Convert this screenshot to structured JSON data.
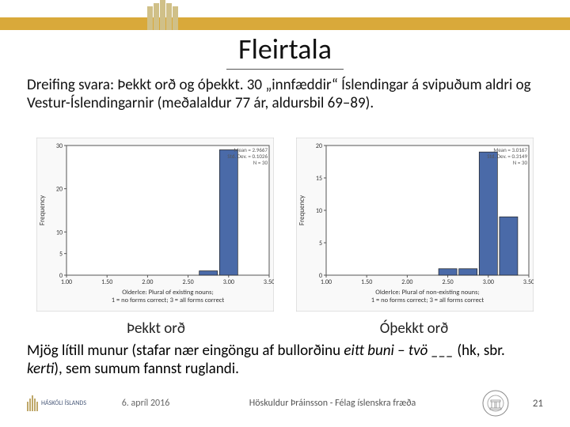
{
  "title": "Fleirtala",
  "body_text": "Dreifing svara: Þekkt orð og óþekkt. 30 „innfæddir“ Íslendingar á svipuðum aldri og Vestur-Íslendingarnir (meðalaldur 77 ár, aldursbil 69–89).",
  "chart_data": [
    {
      "type": "bar",
      "title": "",
      "ylabel": "Frequency",
      "xlabel": "OlderIce: Plural of existing nouns;\n1 = no forms correct; 3 = all forms correct",
      "xlim": [
        1.0,
        3.5
      ],
      "ylim": [
        0,
        30
      ],
      "yticks": [
        0,
        5,
        10,
        20,
        30
      ],
      "bars": [
        {
          "x": 2.75,
          "value": 1,
          "fill": "#4a6aa8"
        },
        {
          "x": 3.0,
          "value": 29,
          "fill": "#4a6aa8"
        }
      ],
      "stats": {
        "mean": "2.9667",
        "stddev": "0.1026",
        "n": "30"
      },
      "caption": "Þekkt orð"
    },
    {
      "type": "bar",
      "title": "",
      "ylabel": "Frequency",
      "xlabel": "OlderIce: Plural of non-existing nouns;\n1 = no forms correct; 3 = all forms correct",
      "xlim": [
        1.0,
        3.5
      ],
      "ylim": [
        0,
        20
      ],
      "yticks": [
        0,
        5,
        10,
        15,
        20
      ],
      "bars": [
        {
          "x": 2.5,
          "value": 1,
          "fill": "#4a6aa8"
        },
        {
          "x": 2.75,
          "value": 1,
          "fill": "#4a6aa8"
        },
        {
          "x": 3.0,
          "value": 19,
          "fill": "#4a6aa8"
        },
        {
          "x": 3.25,
          "value": 9,
          "fill": "#4a6aa8"
        }
      ],
      "stats": {
        "mean": "3.0167",
        "stddev": "0.3149",
        "n": "30"
      },
      "caption": "Óþekkt orð"
    }
  ],
  "lower_text": {
    "pre": "Mjög lítill munur (stafar nær eingöngu af bullorðinu ",
    "it1": "eitt buni",
    "mid": " – ",
    "it2": "tvö ___",
    "paren": " (hk, sbr. ",
    "it3": "kerti",
    "post": "), sem sumum fannst ruglandi."
  },
  "footer": {
    "uni_label": "HÁSKÓLI ÍSLANDS",
    "date": "6. apríl 2016",
    "center": "Höskuldur Þráinsson - Félag íslenskra fræða",
    "page": "21"
  }
}
